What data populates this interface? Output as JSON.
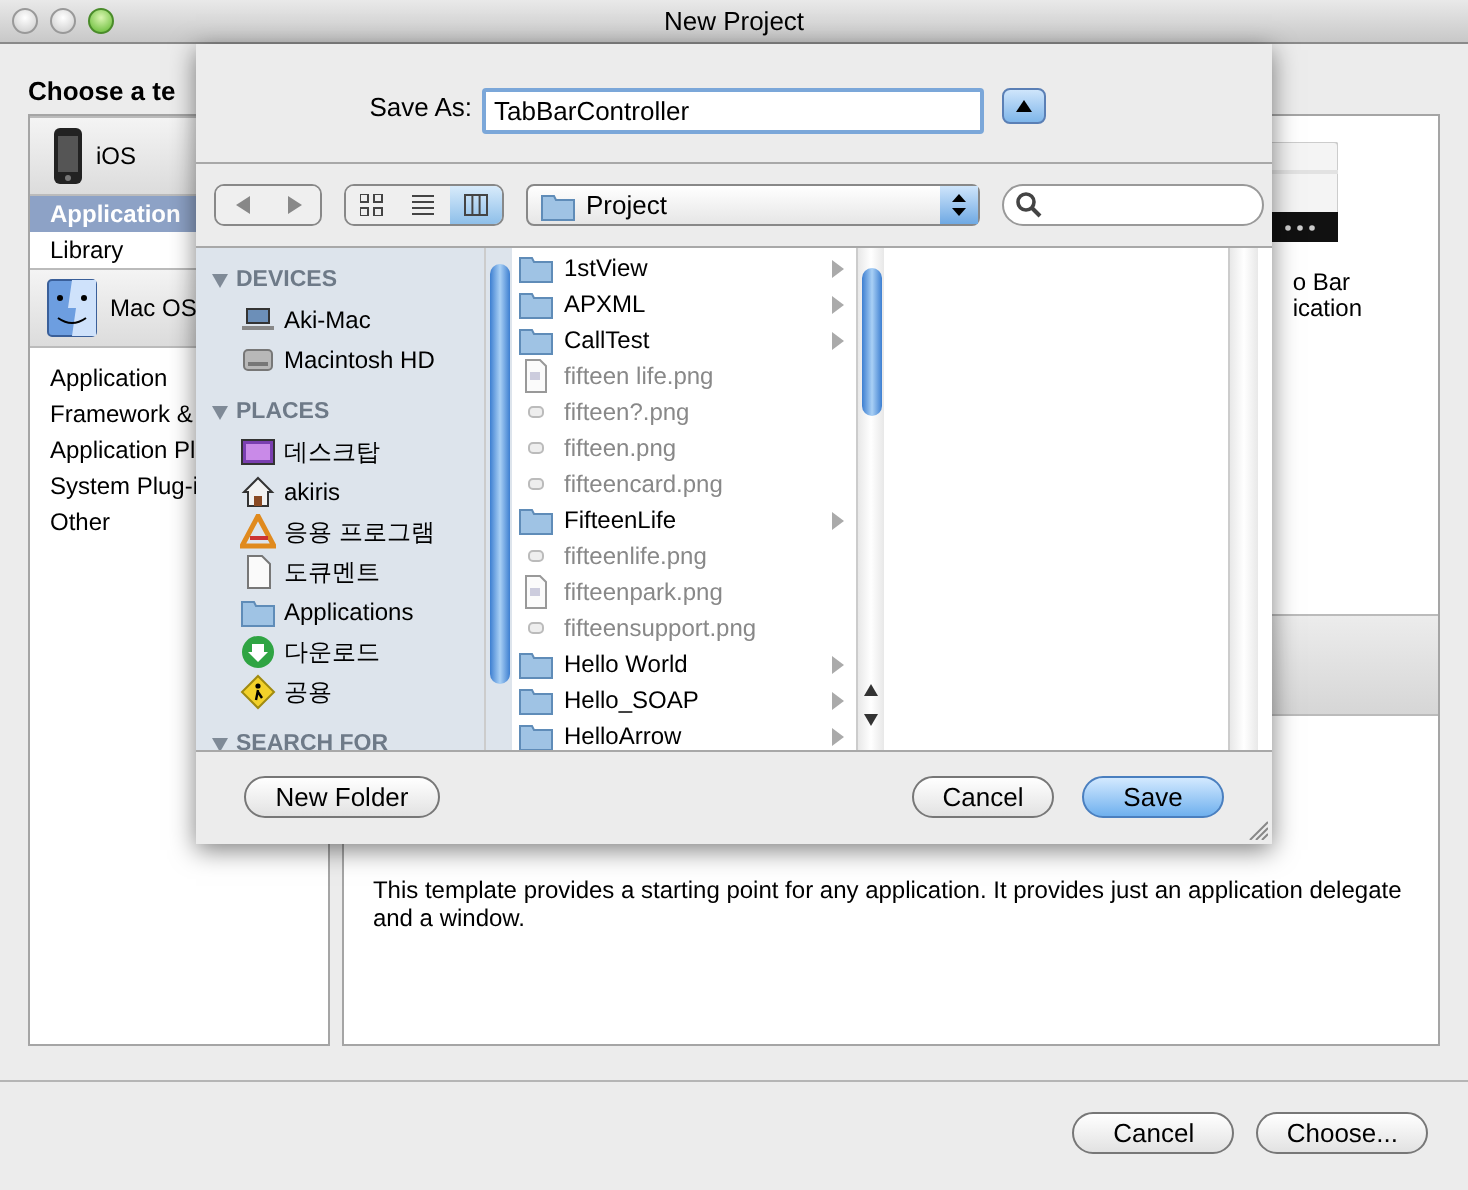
{
  "window": {
    "title": "New Project"
  },
  "chooser": {
    "heading": "Choose a te",
    "groups": [
      {
        "label": "iOS",
        "kind": "phone",
        "items": [
          {
            "label": "Application",
            "selected": true
          },
          {
            "label": "Library",
            "selected": false
          }
        ]
      },
      {
        "label": "Mac OS",
        "kind": "finder",
        "items": [
          {
            "label": "Application",
            "selected": false
          },
          {
            "label": "Framework &",
            "selected": false
          },
          {
            "label": "Application Pl",
            "selected": false
          },
          {
            "label": "System Plug-i",
            "selected": false
          },
          {
            "label": "Other",
            "selected": false
          }
        ]
      }
    ],
    "template_label": [
      "o Bar",
      "ication"
    ],
    "description": "This template provides a starting point for any application. It provides just an application delegate and a window.",
    "buttons": [
      "Cancel",
      "Choose..."
    ]
  },
  "sheet": {
    "save_as_label": "Save As:",
    "save_as_value": "TabBarController",
    "view_buttons": [
      {
        "kind": "icons",
        "selected": false
      },
      {
        "kind": "list",
        "selected": false
      },
      {
        "kind": "columns",
        "selected": true
      }
    ],
    "location": "Project",
    "sidebar": [
      {
        "title": "DEVICES",
        "items": [
          {
            "label": "Aki-Mac",
            "kind": "laptop"
          },
          {
            "label": "Macintosh HD",
            "kind": "disk"
          }
        ]
      },
      {
        "title": "PLACES",
        "items": [
          {
            "label": "데스크탑",
            "kind": "desktop"
          },
          {
            "label": "akiris",
            "kind": "home"
          },
          {
            "label": "응용 프로그램",
            "kind": "apps"
          },
          {
            "label": "도큐멘트",
            "kind": "document"
          },
          {
            "label": "Applications",
            "kind": "folder"
          },
          {
            "label": "다운로드",
            "kind": "download"
          },
          {
            "label": "공용",
            "kind": "shared"
          }
        ]
      },
      {
        "title": "SEARCH FOR"
      }
    ],
    "files": [
      {
        "name": "1stView",
        "kind": "folder"
      },
      {
        "name": "APXML",
        "kind": "folder"
      },
      {
        "name": "CallTest",
        "kind": "folder"
      },
      {
        "name": "fifteen life.png",
        "kind": "image"
      },
      {
        "name": "fifteen?.png",
        "kind": "file"
      },
      {
        "name": "fifteen.png",
        "kind": "file"
      },
      {
        "name": "fifteencard.png",
        "kind": "file"
      },
      {
        "name": "FifteenLife",
        "kind": "folder"
      },
      {
        "name": "fifteenlife.png",
        "kind": "file"
      },
      {
        "name": "fifteenpark.png",
        "kind": "image"
      },
      {
        "name": "fifteensupport.png",
        "kind": "file"
      },
      {
        "name": "Hello World",
        "kind": "folder"
      },
      {
        "name": "Hello_SOAP",
        "kind": "folder"
      },
      {
        "name": "HelloArrow",
        "kind": "folder"
      }
    ],
    "buttons": [
      {
        "label": "New Folder",
        "kind": "secondary"
      },
      {
        "label": "Cancel",
        "kind": "secondary"
      },
      {
        "label": "Save",
        "kind": "default"
      }
    ]
  }
}
